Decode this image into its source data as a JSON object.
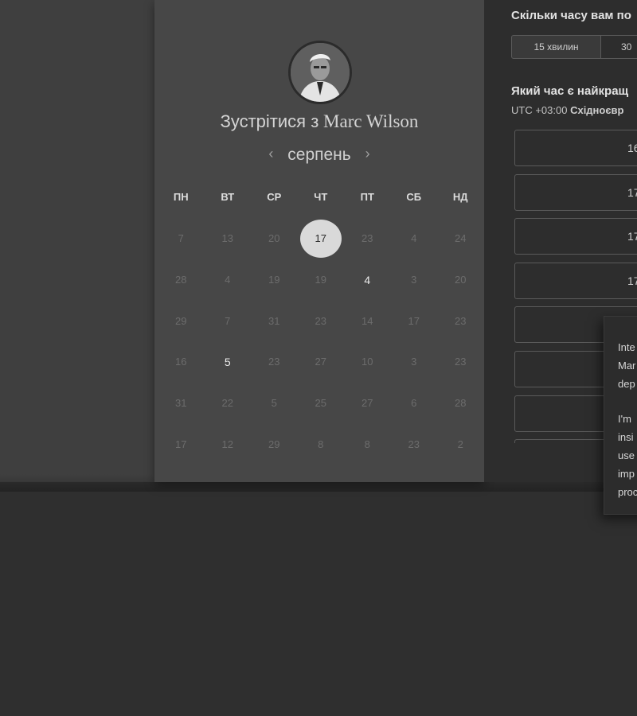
{
  "host": {
    "title_prefix": "Зустрітися з",
    "name": "Marc Wilson"
  },
  "calendar": {
    "month": "серпень",
    "prev_icon": "chevron-left-icon",
    "next_icon": "chevron-right-icon",
    "weekdays": [
      "ПН",
      "ВТ",
      "СР",
      "ЧТ",
      "ПТ",
      "СБ",
      "НД"
    ],
    "weeks": [
      [
        "7",
        "13",
        "20",
        "17",
        "23",
        "4",
        "24"
      ],
      [
        "28",
        "4",
        "19",
        "19",
        "4",
        "3",
        "20"
      ],
      [
        "29",
        "7",
        "31",
        "23",
        "14",
        "17",
        "23"
      ],
      [
        "16",
        "5",
        "23",
        "27",
        "10",
        "3",
        "23"
      ],
      [
        "31",
        "22",
        "5",
        "25",
        "27",
        "6",
        "28"
      ],
      [
        "17",
        "12",
        "29",
        "8",
        "8",
        "23",
        "2"
      ]
    ]
  },
  "duration": {
    "question": "Скільки часу вам по",
    "options": [
      "15 хвилин",
      "30"
    ]
  },
  "time": {
    "question": "Який час є найкращ",
    "timezone_offset": "UTC +03:00",
    "timezone_name": "Східноєвр",
    "slots": [
      "16",
      "17",
      "17",
      "17",
      "",
      "",
      "",
      ""
    ]
  },
  "tooltip": {
    "lines": [
      "Inte",
      "Mar",
      "dep",
      "",
      "I'm",
      "insi",
      "use",
      "imp",
      "proc"
    ]
  }
}
